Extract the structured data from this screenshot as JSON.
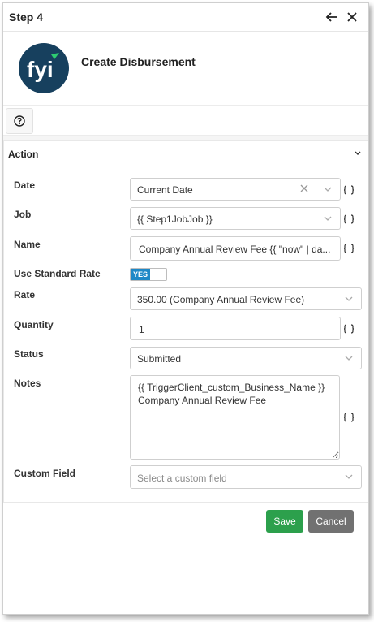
{
  "header": {
    "title": "Step 4"
  },
  "step": {
    "name": "Create Disbursement",
    "logo_text": "fyi"
  },
  "section": {
    "title": "Action"
  },
  "fields": {
    "date": {
      "label": "Date",
      "value": "Current Date"
    },
    "job": {
      "label": "Job",
      "value": "{{ Step1JobJob }}"
    },
    "name": {
      "label": "Name",
      "value": "Company Annual Review Fee {{ \"now\" | da..."
    },
    "use_standard_rate": {
      "label": "Use Standard Rate",
      "toggle_text": "YES"
    },
    "rate": {
      "label": "Rate",
      "value": "350.00 (Company Annual Review Fee)"
    },
    "quantity": {
      "label": "Quantity",
      "value": "1"
    },
    "status": {
      "label": "Status",
      "value": "Submitted"
    },
    "notes": {
      "label": "Notes",
      "value": "{{ TriggerClient_custom_Business_Name }}\nCompany Annual Review Fee"
    },
    "custom_field": {
      "label": "Custom Field",
      "placeholder": "Select a custom field"
    }
  },
  "buttons": {
    "save": "Save",
    "cancel": "Cancel"
  },
  "colors": {
    "primary": "#1e88c7",
    "save": "#2ca04c",
    "cancel": "#717171",
    "logo_bg": "#17405e",
    "logo_accent": "#2ecc71"
  }
}
